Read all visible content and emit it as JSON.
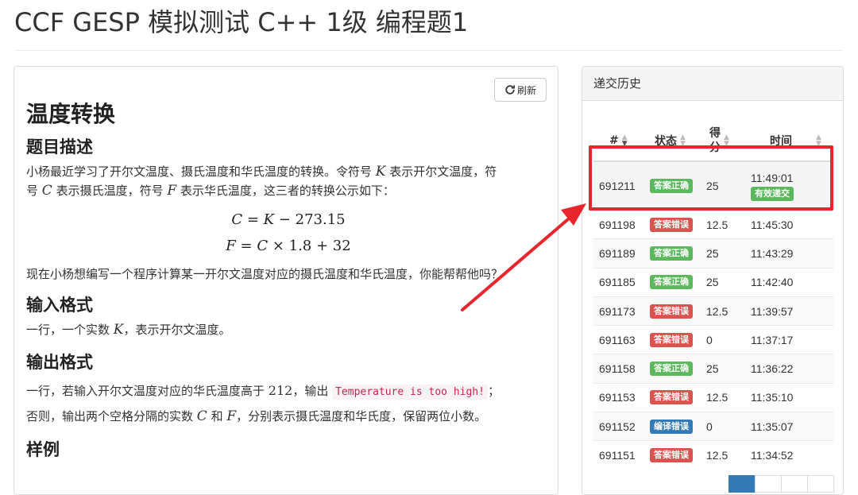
{
  "page": {
    "title": "CCF GESP 模拟测试 C++ 1级 编程题1"
  },
  "problem": {
    "refresh_label": "刷新",
    "heading": "温度转换",
    "description_heading": "题目描述",
    "desc": {
      "p1_a": "小杨最近学习了开尔文温度、摄氏温度和华氏温度的转换。令符号 ",
      "var_k": "K",
      "p1_b": " 表示开尔文温度，符",
      "p1_c": "号 ",
      "var_c": "C",
      "p1_d": " 表示摄氏温度，符号 ",
      "var_f": "F",
      "p1_e": " 表示华氏温度，这三者的转换公示如下："
    },
    "formula1": {
      "lhs": "C",
      "eq": " = ",
      "var": "K",
      "rest": " − 273.15"
    },
    "formula2": {
      "lhs": "F",
      "eq": " = ",
      "var": "C",
      "rest": " × 1.8 + 32"
    },
    "desc2": "现在小杨想编写一个程序计算某一开尔文温度对应的摄氏温度和华氏温度，你能帮帮他吗？",
    "input_heading": "输入格式",
    "input": {
      "a": "一行，一个实数 ",
      "var": "K",
      "b": "，表示开尔文温度。"
    },
    "output_heading": "输出格式",
    "output": {
      "a": "一行，若输入开尔文温度对应的华氏温度高于 ",
      "num": "212",
      "b": "，输出 ",
      "code": "Temperature is too high!",
      "c": "；",
      "d": "否则，输出两个空格分隔的实数 ",
      "var_c": "C",
      "e": " 和 ",
      "var_f": "F",
      "f": "，分别表示摄氏温度和华氏度，保留两位小数。"
    },
    "sample_heading": "样例"
  },
  "history": {
    "title": "递交历史",
    "columns": {
      "id": "#",
      "status": "状态",
      "score_1": "得",
      "score_2": "分",
      "time": "时间"
    },
    "valid_label": "有效递交",
    "rows": [
      {
        "id": "691211",
        "status": "答案正确",
        "color": "#5cb85c",
        "score": "25",
        "time": "11:49:01"
      },
      {
        "id": "691198",
        "status": "答案错误",
        "color": "#d9534f",
        "score": "12.5",
        "time": "11:45:30"
      },
      {
        "id": "691189",
        "status": "答案正确",
        "color": "#5cb85c",
        "score": "25",
        "time": "11:43:29"
      },
      {
        "id": "691185",
        "status": "答案正确",
        "color": "#5cb85c",
        "score": "25",
        "time": "11:42:40"
      },
      {
        "id": "691173",
        "status": "答案错误",
        "color": "#d9534f",
        "score": "12.5",
        "time": "11:39:57"
      },
      {
        "id": "691163",
        "status": "答案错误",
        "color": "#d9534f",
        "score": "0",
        "time": "11:37:17"
      },
      {
        "id": "691158",
        "status": "答案正确",
        "color": "#5cb85c",
        "score": "25",
        "time": "11:36:22"
      },
      {
        "id": "691153",
        "status": "答案错误",
        "color": "#d9534f",
        "score": "12.5",
        "time": "11:35:10"
      },
      {
        "id": "691152",
        "status": "编译错误",
        "color": "#337ab7",
        "score": "0",
        "time": "11:35:07"
      },
      {
        "id": "691151",
        "status": "答案错误",
        "color": "#d9534f",
        "score": "12.5",
        "time": "11:34:52"
      }
    ]
  },
  "annotation": {
    "color": "#e8262d"
  }
}
